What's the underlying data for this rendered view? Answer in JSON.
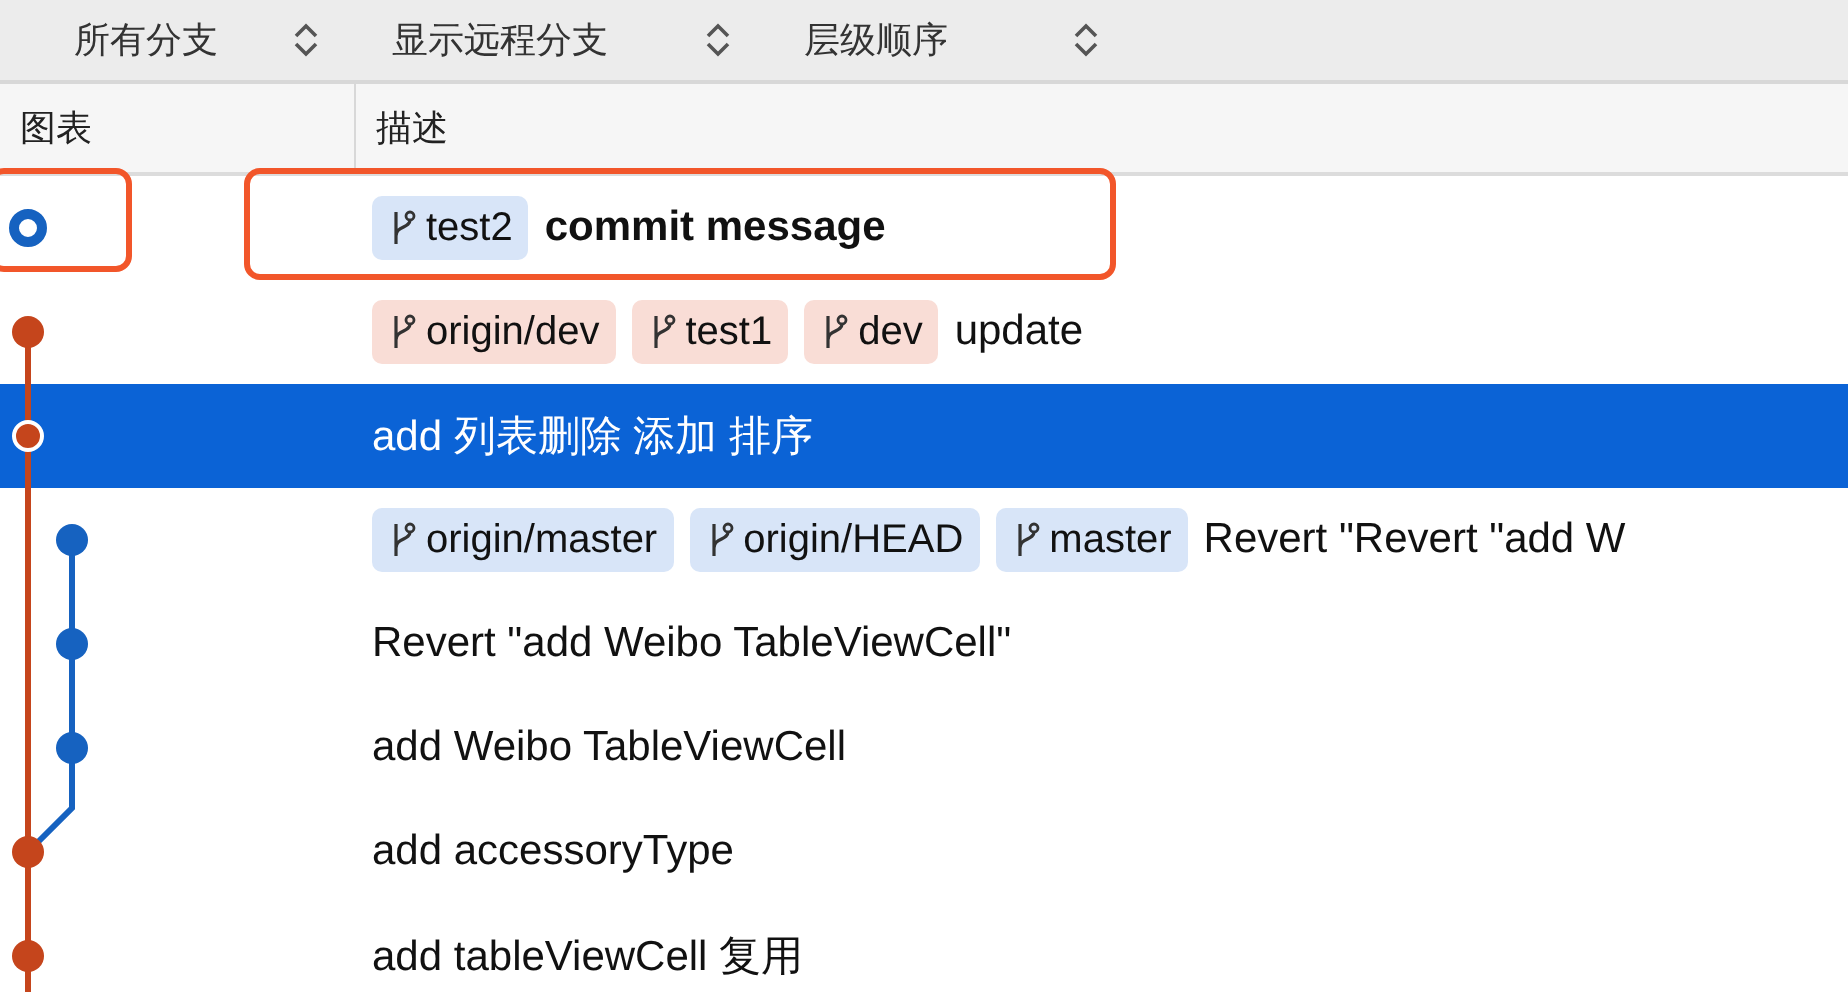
{
  "toolbar": [
    {
      "label": "所有分支"
    },
    {
      "label": "显示远程分支"
    },
    {
      "label": "层级顺序"
    }
  ],
  "columns": [
    {
      "label": "图表"
    },
    {
      "label": "描述"
    }
  ],
  "commits": [
    {
      "refs": [
        {
          "name": "test2",
          "color": "#d8e5f8"
        }
      ],
      "message": "commit message",
      "bold": true,
      "selected": false,
      "annotated": true
    },
    {
      "refs": [
        {
          "name": "origin/dev",
          "color": "#f9ddd6"
        },
        {
          "name": "test1",
          "color": "#f9ddd6"
        },
        {
          "name": "dev",
          "color": "#f9ddd6"
        }
      ],
      "message": "update",
      "bold": false,
      "selected": false,
      "annotated": false
    },
    {
      "message": "add 列表删除 添加 排序",
      "bold": false,
      "selected": true,
      "annotated": false
    },
    {
      "refs": [
        {
          "name": "origin/master",
          "color": "#d8e5f8"
        },
        {
          "name": "origin/HEAD",
          "color": "#d8e5f8"
        },
        {
          "name": "master",
          "color": "#d8e5f8"
        }
      ],
      "message": "Revert \"Revert \"add W",
      "bold": false,
      "selected": false,
      "annotated": false
    },
    {
      "message": "Revert \"add Weibo TableViewCell\"",
      "bold": false,
      "selected": false,
      "annotated": false
    },
    {
      "message": "add Weibo TableViewCell",
      "bold": false,
      "selected": false,
      "annotated": false
    },
    {
      "message": "add accessoryType",
      "bold": false,
      "selected": false,
      "annotated": false
    },
    {
      "message": "add tableViewCell 复用",
      "bold": false,
      "selected": false,
      "annotated": false
    }
  ]
}
